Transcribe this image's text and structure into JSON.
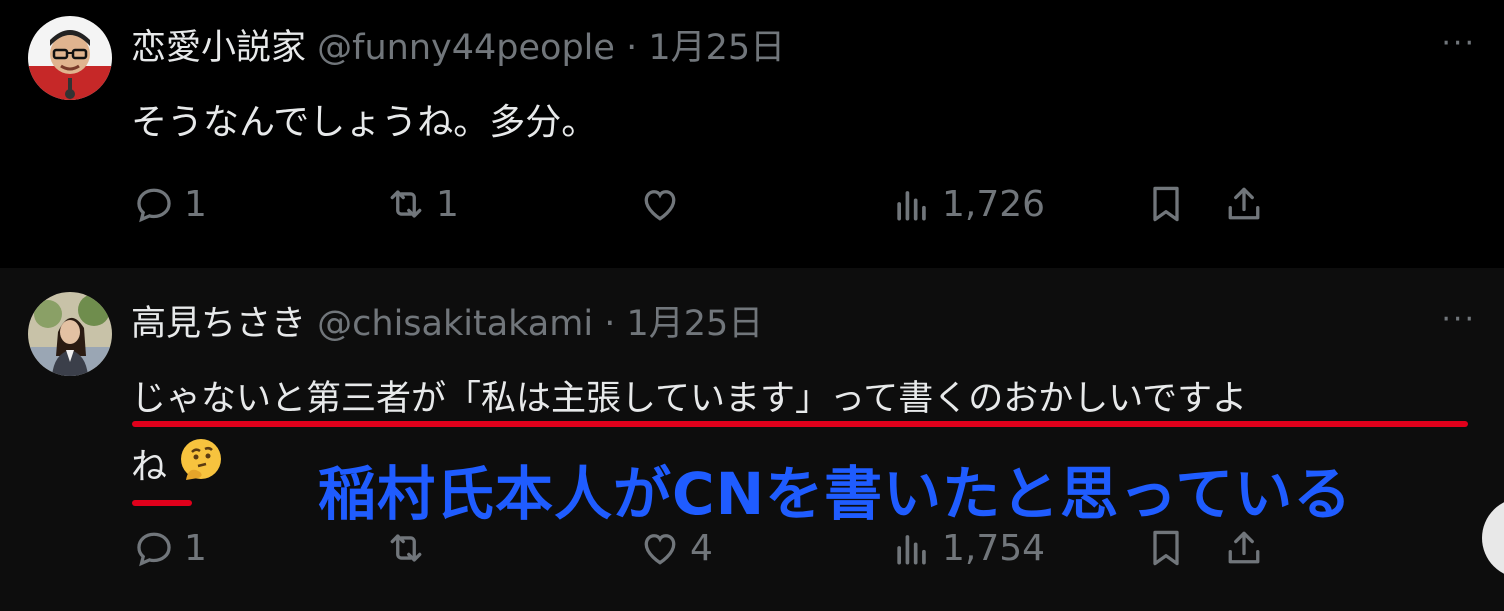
{
  "tweets": [
    {
      "name": "恋愛小説家",
      "handle": "@funny44people",
      "separator": "·",
      "date": "1月25日",
      "text": "そうなんでしょうね。多分。",
      "more": "···",
      "actions": {
        "replies": "1",
        "retweets": "1",
        "likes": "",
        "views": "1,726"
      }
    },
    {
      "name": "高見ちさき",
      "handle": "@chisakitakami",
      "separator": "·",
      "date": "1月25日",
      "text_line1": "じゃないと第三者が「私は主張しています」って書くのおかしいですよ",
      "text_line2": "ね",
      "more": "···",
      "actions": {
        "replies": "1",
        "retweets": "",
        "likes": "4",
        "views": "1,754"
      }
    }
  ],
  "annotation": "稲村氏本人がCNを書いたと思っている",
  "colors": {
    "annotation": "#1f5cff",
    "underline": "#e0001b",
    "muted": "#71767b"
  },
  "icons": [
    "reply-icon",
    "retweet-icon",
    "like-icon",
    "views-icon",
    "bookmark-icon",
    "share-icon",
    "more-icon",
    "thinking-face-emoji"
  ]
}
